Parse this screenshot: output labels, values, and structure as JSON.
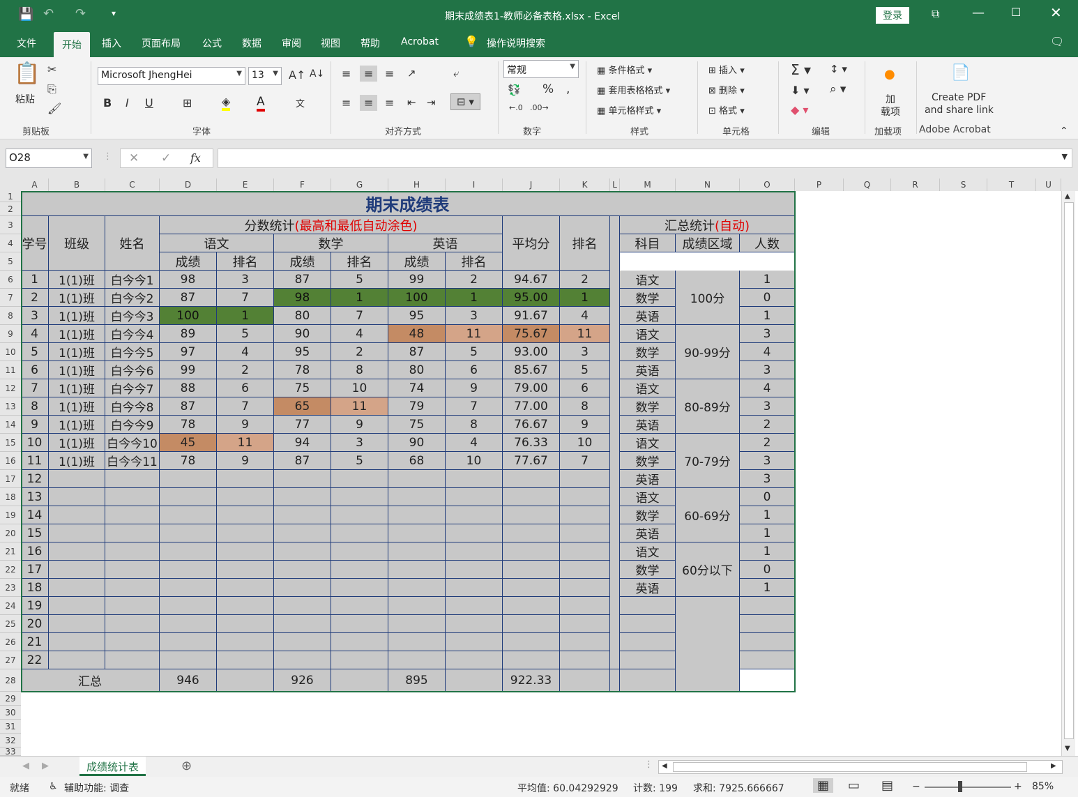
{
  "app": {
    "title": "期末成绩表1-教师必备表格.xlsx  -  Excel",
    "login": "登录"
  },
  "tabs": [
    "文件",
    "开始",
    "插入",
    "页面布局",
    "公式",
    "数据",
    "审阅",
    "视图",
    "帮助",
    "Acrobat",
    "操作说明搜索"
  ],
  "ribbon": {
    "paste": "粘贴",
    "font_name": "Microsoft JhengHei",
    "font_size": "13",
    "number_format": "常规",
    "cond_format": "条件格式",
    "table_format": "套用表格格式",
    "cell_style": "单元格样式",
    "insert": "插入",
    "delete": "删除",
    "format": "格式",
    "addin_1": "加",
    "addin_2": "载项",
    "pdf_1": "Create PDF",
    "pdf_2": "and share link",
    "groups": [
      "剪贴板",
      "字体",
      "对齐方式",
      "数字",
      "样式",
      "单元格",
      "编辑",
      "加载项",
      "Adobe Acrobat"
    ]
  },
  "formula_bar": {
    "name_box": "O28",
    "fx": "fx",
    "value": ""
  },
  "columns": [
    "A",
    "B",
    "C",
    "D",
    "E",
    "F",
    "G",
    "H",
    "I",
    "J",
    "K",
    "L",
    "M",
    "N",
    "O",
    "P",
    "Q",
    "R",
    "S",
    "T",
    "U"
  ],
  "row_numbers": [
    "1",
    "2",
    "3",
    "4",
    "5",
    "6",
    "7",
    "8",
    "9",
    "10",
    "11",
    "12",
    "13",
    "14",
    "15",
    "16",
    "17",
    "18",
    "19",
    "20",
    "21",
    "22",
    "23",
    "24",
    "25",
    "26",
    "27",
    "28",
    "29",
    "30",
    "31",
    "32",
    "33"
  ],
  "sheet": {
    "title": "期末成绩表",
    "score_stats": "分数统计",
    "score_stats_note": "(最高和最低自动涂色)",
    "summary": "汇总统计",
    "summary_note": "(自动)",
    "h_no": "学号",
    "h_class": "班级",
    "h_name": "姓名",
    "h_chinese": "语文",
    "h_math": "数学",
    "h_english": "英语",
    "h_score": "成绩",
    "h_rank": "排名",
    "h_avg": "平均分",
    "h_rank2": "排名",
    "h_subject": "科目",
    "h_area": "成绩区域",
    "h_count": "人数",
    "students": [
      [
        "1",
        "1(1)班",
        "白今今1",
        "98",
        "3",
        "87",
        "5",
        "99",
        "2",
        "94.67",
        "2"
      ],
      [
        "2",
        "1(1)班",
        "白今今2",
        "87",
        "7",
        "98",
        "1",
        "100",
        "1",
        "95.00",
        "1"
      ],
      [
        "3",
        "1(1)班",
        "白今今3",
        "100",
        "1",
        "80",
        "7",
        "95",
        "3",
        "91.67",
        "4"
      ],
      [
        "4",
        "1(1)班",
        "白今今4",
        "89",
        "5",
        "90",
        "4",
        "48",
        "11",
        "75.67",
        "11"
      ],
      [
        "5",
        "1(1)班",
        "白今今5",
        "97",
        "4",
        "95",
        "2",
        "87",
        "5",
        "93.00",
        "3"
      ],
      [
        "6",
        "1(1)班",
        "白今今6",
        "99",
        "2",
        "78",
        "8",
        "80",
        "6",
        "85.67",
        "5"
      ],
      [
        "7",
        "1(1)班",
        "白今今7",
        "88",
        "6",
        "75",
        "10",
        "74",
        "9",
        "79.00",
        "6"
      ],
      [
        "8",
        "1(1)班",
        "白今今8",
        "87",
        "7",
        "65",
        "11",
        "79",
        "7",
        "77.00",
        "8"
      ],
      [
        "9",
        "1(1)班",
        "白今今9",
        "78",
        "9",
        "77",
        "9",
        "75",
        "8",
        "76.67",
        "9"
      ],
      [
        "10",
        "1(1)班",
        "白今今10",
        "45",
        "11",
        "94",
        "3",
        "90",
        "4",
        "76.33",
        "10"
      ],
      [
        "11",
        "1(1)班",
        "白今今11",
        "78",
        "9",
        "87",
        "5",
        "68",
        "10",
        "77.67",
        "7"
      ]
    ],
    "empty_ids": [
      "12",
      "13",
      "14",
      "15",
      "16",
      "17",
      "18",
      "19",
      "20",
      "21",
      "22"
    ],
    "total_label": "汇总",
    "totals": [
      "946",
      "926",
      "895",
      "922.33"
    ],
    "areas": [
      "100分",
      "90-99分",
      "80-89分",
      "70-79分",
      "60-69分",
      "60分以下"
    ],
    "subjects": [
      "语文",
      "数学",
      "英语"
    ],
    "counts": [
      "1",
      "0",
      "1",
      "3",
      "4",
      "3",
      "4",
      "3",
      "2",
      "2",
      "3",
      "3",
      "0",
      "1",
      "1",
      "1",
      "0",
      "1"
    ]
  },
  "sheet_tab": "成绩统计表",
  "status": {
    "ready": "就绪",
    "access": "辅助功能: 调查",
    "avg": "平均值: 60.04292929",
    "count": "计数: 199",
    "sum": "求和: 7925.666667",
    "zoom": "85%"
  },
  "colors": {
    "accent": "#217346",
    "max": "#538135",
    "min": "#c48b64",
    "border": "#1f3b7a"
  }
}
